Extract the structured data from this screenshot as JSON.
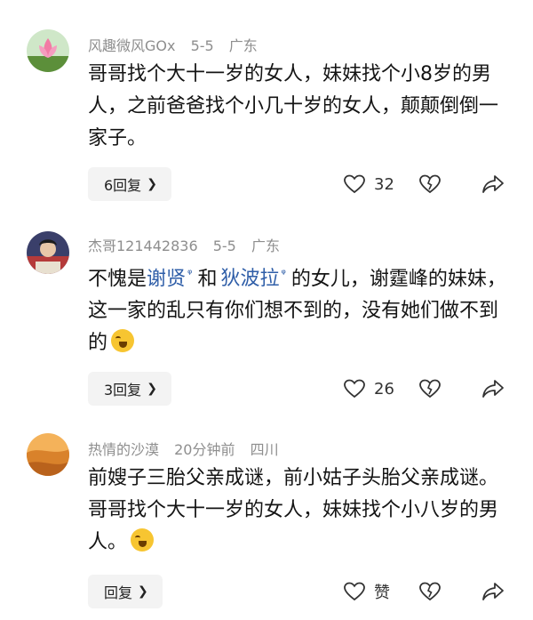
{
  "comments": [
    {
      "username": "风趣微风GOx",
      "date": "5-5",
      "location": "广东",
      "text": "哥哥找个大十一岁的女人，妹妹找个小8岁的男人，之前爸爸找个小几十岁的女人，颠颠倒倒一家子。",
      "reply_label": "6回复",
      "likes": "32"
    },
    {
      "username": "杰哥121442836",
      "date": "5-5",
      "location": "广东",
      "text_parts": [
        "不愧是",
        "谢贤",
        "和",
        "狄波拉",
        "的女儿，谢霆峰的妹妹，这一家的乱只有你们想不到的，没有她们做不到的"
      ],
      "reply_label": "3回复",
      "likes": "26"
    },
    {
      "username": "热情的沙漠",
      "date": "20分钟前",
      "location": "四川",
      "text": "前嫂子三胎父亲成谜，前小姑子头胎父亲成谜。哥哥找个大十一岁的女人，妹妹找个小八岁的男人。",
      "reply_label": "回复",
      "likes": "赞"
    }
  ],
  "icons": {
    "like": "heart-outline-icon",
    "dislike": "broken-heart-icon",
    "share": "share-arrow-icon",
    "reply_chevron": "chevron-right-icon",
    "search_mark": "search-icon",
    "emoji": "crying-laughing-emoji-icon"
  }
}
